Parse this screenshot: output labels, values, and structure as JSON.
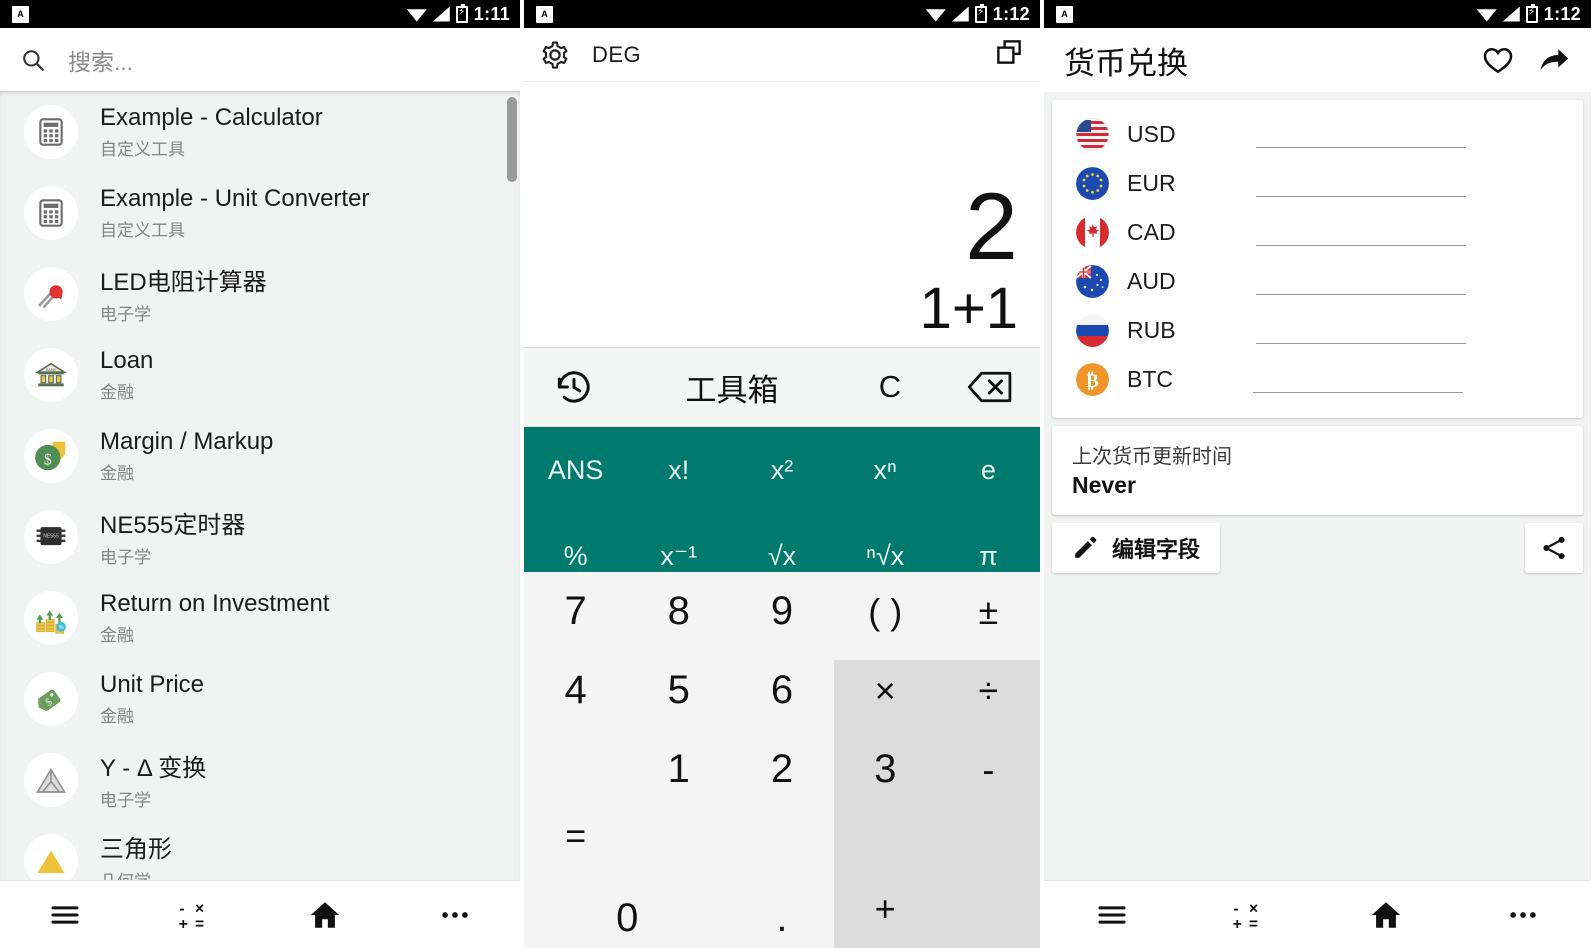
{
  "status_bar": {
    "app_badge": "A",
    "time_left": "1:11",
    "time_mid": "1:12",
    "time_right": "1:12"
  },
  "panel1": {
    "search": {
      "placeholder": "搜索...",
      "icon": "search-icon"
    },
    "items": [
      {
        "title": "Example - Calculator",
        "subtitle": "自定义工具",
        "icon": "calculator-icon"
      },
      {
        "title": "Example - Unit Converter",
        "subtitle": "自定义工具",
        "icon": "calculator-icon"
      },
      {
        "title": "LED电阻计算器",
        "subtitle": "电子学",
        "icon": "led-icon"
      },
      {
        "title": "Loan",
        "subtitle": "金融",
        "icon": "bank-icon"
      },
      {
        "title": "Margin / Markup",
        "subtitle": "金融",
        "icon": "money-tag-icon"
      },
      {
        "title": "NE555定时器",
        "subtitle": "电子学",
        "icon": "chip-icon"
      },
      {
        "title": "Return on Investment",
        "subtitle": "金融",
        "icon": "growth-chart-icon"
      },
      {
        "title": "Unit Price",
        "subtitle": "金融",
        "icon": "price-tag-icon"
      },
      {
        "title": "Y - Δ 变换",
        "subtitle": "电子学",
        "icon": "triangle-outline-icon"
      },
      {
        "title": "三角形",
        "subtitle": "几何学",
        "icon": "triangle-yellow-icon"
      }
    ],
    "nav": [
      {
        "name": "menu",
        "icon": "hamburger-icon"
      },
      {
        "name": "calculator",
        "icon": "calculator-ops-icon"
      },
      {
        "name": "home",
        "icon": "home-icon"
      },
      {
        "name": "more",
        "icon": "more-horizontal-icon"
      }
    ]
  },
  "panel2": {
    "toolbar": {
      "settings_icon": "gear-icon",
      "angle_mode": "DEG",
      "window_icon": "copy-windows-icon"
    },
    "display": {
      "result": "2",
      "expression": "1+1"
    },
    "tools": [
      {
        "label": "",
        "name": "history",
        "icon": "history-clock-icon"
      },
      {
        "label": "工具箱",
        "name": "toolbox",
        "icon": ""
      },
      {
        "label": "C",
        "name": "clear",
        "icon": ""
      },
      {
        "label": "",
        "name": "backspace",
        "icon": "backspace-icon"
      }
    ],
    "functions": [
      "ANS",
      "x!",
      "x²",
      "xⁿ",
      "e",
      "%",
      "x⁻¹",
      "√x",
      "ⁿ√x",
      "π"
    ],
    "keypad": [
      "7",
      "8",
      "9",
      "( )",
      "±",
      "4",
      "5",
      "6",
      "×",
      "÷",
      "1",
      "2",
      "3",
      "-",
      "=",
      "0",
      ".",
      "+"
    ],
    "accent_color": "#017a6e",
    "operator_bg": "#dcdcdc"
  },
  "panel3": {
    "header": {
      "title": "货币兑换",
      "favorite_icon": "heart-icon",
      "share_icon": "share-arrow-icon"
    },
    "currencies": [
      {
        "code": "USD",
        "flag": "us-flag-icon",
        "value": ""
      },
      {
        "code": "EUR",
        "flag": "eu-flag-icon",
        "value": ""
      },
      {
        "code": "CAD",
        "flag": "ca-flag-icon",
        "value": ""
      },
      {
        "code": "AUD",
        "flag": "au-flag-icon",
        "value": ""
      },
      {
        "code": "RUB",
        "flag": "ru-flag-icon",
        "value": ""
      },
      {
        "code": "BTC",
        "flag": "bitcoin-icon",
        "value": ""
      }
    ],
    "update": {
      "label": "上次货币更新时间",
      "value": "Never"
    },
    "actions": {
      "edit_label": "编辑字段",
      "edit_icon": "pencil-icon",
      "share_icon": "share-nodes-icon"
    },
    "nav": [
      {
        "name": "menu",
        "icon": "hamburger-icon"
      },
      {
        "name": "calculator",
        "icon": "calculator-ops-icon"
      },
      {
        "name": "home",
        "icon": "home-icon"
      },
      {
        "name": "more",
        "icon": "more-horizontal-icon"
      }
    ]
  }
}
